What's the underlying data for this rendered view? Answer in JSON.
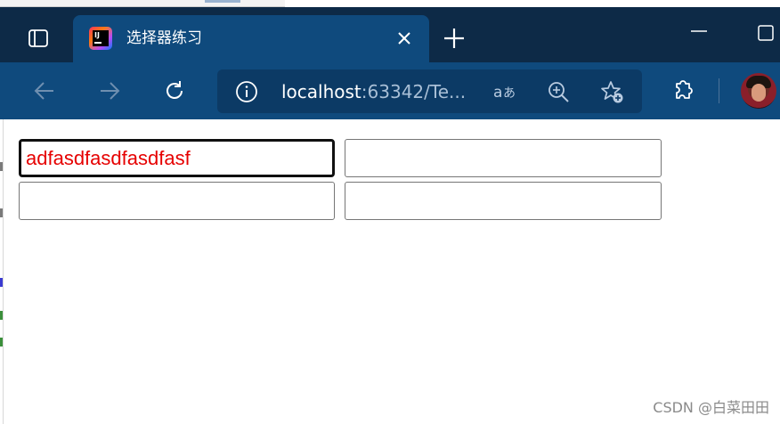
{
  "browser": {
    "tab": {
      "title": "选择器练习"
    },
    "address": {
      "host": "localhost",
      "path": ":63342/Te..."
    }
  },
  "page": {
    "inputs": [
      {
        "value": "adfasdfasdfasdfasf",
        "focused": true
      },
      {
        "value": "",
        "focused": false
      },
      {
        "value": "",
        "focused": false
      },
      {
        "value": "",
        "focused": false
      }
    ],
    "colors": {
      "input_text": "#e60000",
      "titlebar": "#0d2a47",
      "toolbar": "#0f4a7d"
    }
  },
  "watermark": "CSDN @白菜田田",
  "icons": [
    "tab-actions-icon",
    "intellij-favicon-icon",
    "close-icon",
    "plus-icon",
    "minimize-icon",
    "maximize-icon",
    "back-arrow-icon",
    "forward-arrow-icon",
    "reload-icon",
    "info-icon",
    "read-aloud-icon",
    "zoom-icon",
    "favorites-star-icon",
    "extensions-puzzle-icon",
    "profile-avatar"
  ]
}
